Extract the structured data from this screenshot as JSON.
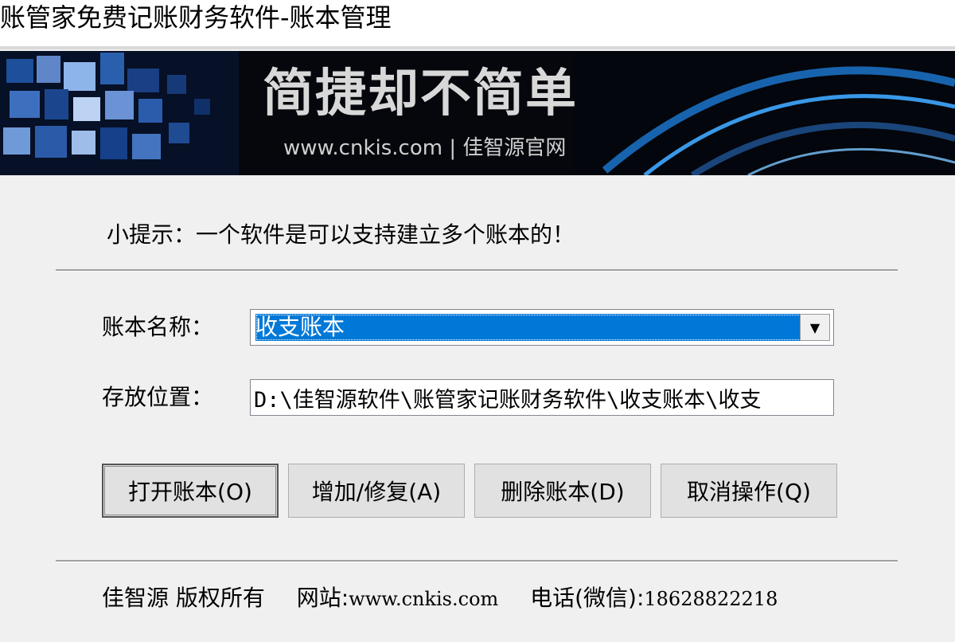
{
  "window": {
    "title": "账管家免费记账财务软件-账本管理"
  },
  "banner": {
    "slogan": "简捷却不简单",
    "site": "www.cnkis.com | 佳智源官网"
  },
  "tip": "小提示：一个软件是可以支持建立多个账本的！",
  "form": {
    "ledger_name_label": "账本名称：",
    "ledger_name_value": "收支账本",
    "location_label": "存放位置：",
    "location_value": "D:\\佳智源软件\\账管家记账财务软件\\收支账本\\收支"
  },
  "buttons": {
    "open": "打开账本(O)",
    "add_repair": "增加/修复(A)",
    "delete": "删除账本(D)",
    "cancel": "取消操作(Q)"
  },
  "footer": {
    "copyright": "佳智源 版权所有",
    "website_label": "网站:",
    "website": "www.cnkis.com",
    "phone_label": "电话(微信):",
    "phone": "18628822218"
  },
  "colors": {
    "selection": "#0078d7",
    "background": "#f0f0f0"
  }
}
